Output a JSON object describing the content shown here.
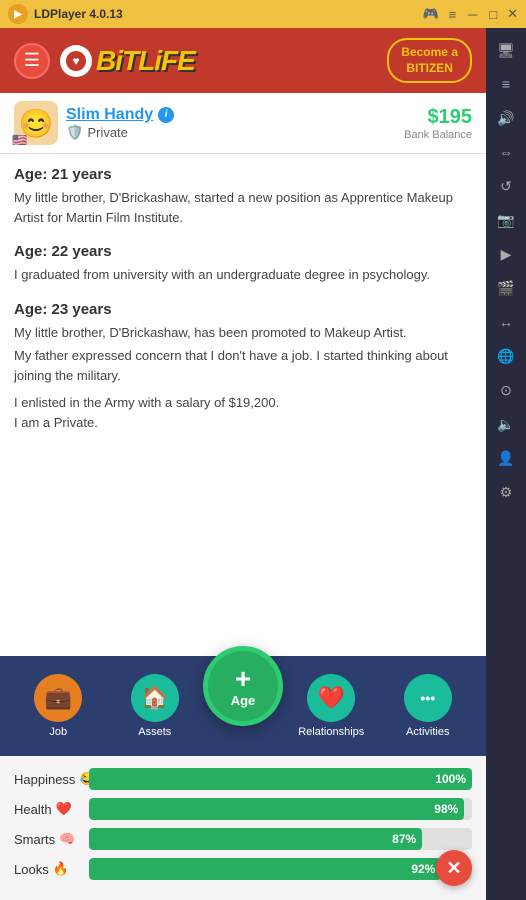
{
  "titlebar": {
    "app_name": "LDPlayer 4.0.13",
    "controls": [
      "gamepad",
      "menu",
      "minimize",
      "maximize",
      "close"
    ]
  },
  "header": {
    "hamburger_label": "☰",
    "logo_text": "BiTLiFE",
    "bitizen_line1": "Become a",
    "bitizen_line2": "BITIZEN"
  },
  "profile": {
    "name": "Slim Handy",
    "rank": "Private",
    "balance": "$195",
    "balance_label": "Bank Balance",
    "avatar_emoji": "😊",
    "flag_emoji": "🇺🇸",
    "rank_icon": "🛡️"
  },
  "story": [
    {
      "age_label": "Age: 21 years",
      "text": "My little brother, D'Brickashaw, started a new position as Apprentice Makeup Artist for Martin Film Institute."
    },
    {
      "age_label": "Age: 22 years",
      "text": "I graduated from university with an undergraduate degree in psychology."
    },
    {
      "age_label": "Age: 23 years",
      "text_parts": [
        "My little brother, D'Brickashaw, has been promoted to Makeup Artist.",
        "My father expressed concern that I don't have a job. I started thinking about joining the military.",
        "",
        "I enlisted in the Army with a salary of $19,200.",
        "I am a Private."
      ]
    }
  ],
  "bottom_nav": {
    "job_label": "Job",
    "job_icon": "💼",
    "job_color": "#e67e22",
    "assets_label": "Assets",
    "assets_icon": "🏠",
    "assets_color": "#1abc9c",
    "age_plus": "+",
    "age_label": "Age",
    "relationships_label": "Relationships",
    "relationships_icon": "❤️",
    "relationships_color": "#1abc9c",
    "activities_label": "Activities",
    "activities_icon": "···",
    "activities_color": "#1abc9c"
  },
  "stats": [
    {
      "label": "Happiness",
      "emoji": "😂",
      "percent": 100,
      "display": "100%"
    },
    {
      "label": "Health",
      "emoji": "❤️",
      "percent": 98,
      "display": "98%"
    },
    {
      "label": "Smarts",
      "emoji": "🧠",
      "percent": 87,
      "display": "87%"
    },
    {
      "label": "Looks",
      "emoji": "🔥",
      "percent": 92,
      "display": "92%"
    }
  ],
  "sidebar_icons": [
    "🖥️",
    "📋",
    "🔊",
    "⇔",
    "🔄",
    "📷",
    "▶️",
    "🎬",
    "↔️",
    "🌐",
    "🔘",
    "🔊",
    "👤",
    "⚙️"
  ],
  "red_x": "✕"
}
